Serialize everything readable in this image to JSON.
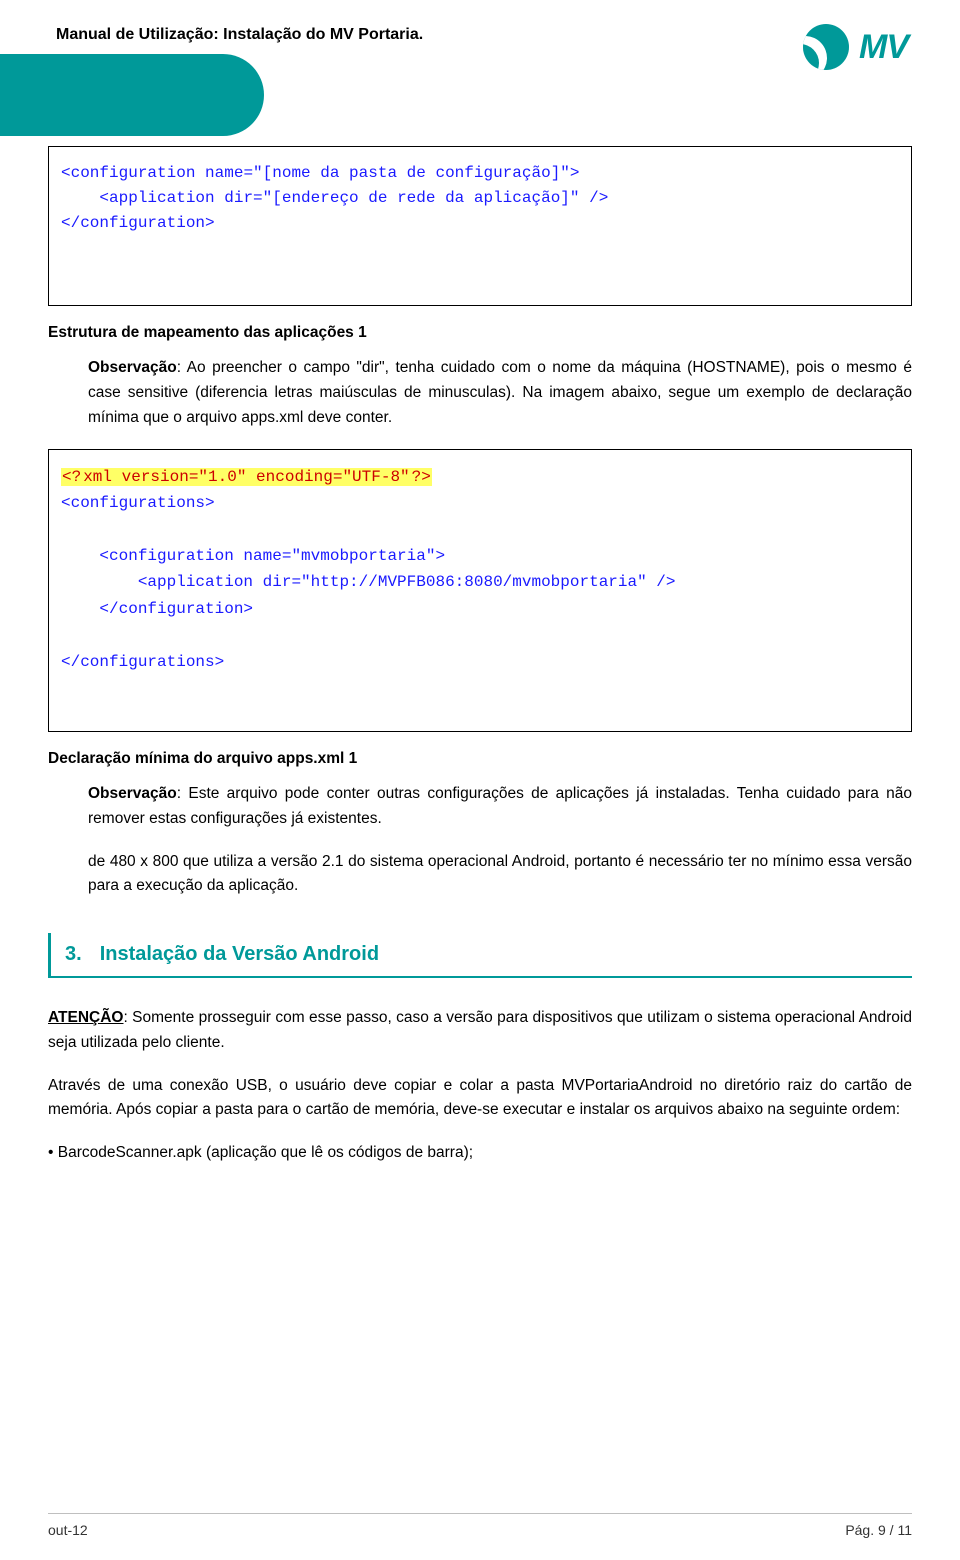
{
  "header": {
    "title": "Manual de Utilização: Instalação do MV Portaria.",
    "logo_text": "MV"
  },
  "codebox1": {
    "line1_open": "<configuration ",
    "line1_attr": "name=\"[nome da pasta de configuração]\">",
    "line2_indent": "    ",
    "line2_open": "<application ",
    "line2_attr": "dir=\"[endereço de rede da aplicação]\" />",
    "line3": "</configuration>"
  },
  "caption1": "Estrutura de mapeamento das aplicações 1",
  "para1": {
    "bold": "Observação",
    "text": ": Ao preencher o campo \"dir\", tenha cuidado com o nome da máquina (HOSTNAME), pois o mesmo é case sensitive (diferencia letras maiúsculas de minusculas). Na imagem abaixo, segue um exemplo de declaração mínima que o arquivo apps.xml deve conter."
  },
  "codebox2": {
    "decl_open": "<?",
    "decl_body": "xml version=\"1.0\" encoding=\"UTF-8\"",
    "decl_close": "?>",
    "l2": "<configurations>",
    "blank": "",
    "l4": "    <configuration name=\"mvmobportaria\">",
    "l5": "        <application dir=\"http://MVPFB086:8080/mvmobportaria\" />",
    "l6": "    </configuration>",
    "l8": "</configurations>"
  },
  "caption2": "Declaração mínima do arquivo apps.xml 1",
  "para2": {
    "bold": "Observação",
    "text": ": Este arquivo pode conter outras configurações de aplicações já instaladas. Tenha cuidado para não remover estas configurações já existentes."
  },
  "para3": "de 480 x 800 que utiliza a versão 2.1 do sistema operacional Android, portanto é necessário ter no mínimo essa versão para a execução da aplicação.",
  "section": {
    "num": "3.",
    "title": "Instalação da Versão Android"
  },
  "para4": {
    "bold": "ATENÇÃO",
    "text": ": Somente prosseguir com esse passo, caso a versão para dispositivos que utilizam o sistema operacional Android seja utilizada pelo cliente."
  },
  "para5": "Através de uma conexão USB, o usuário deve copiar e colar a pasta MVPortariaAndroid no diretório raiz do cartão de memória. Após copiar a pasta para o cartão de memória, deve-se executar e instalar os arquivos abaixo na seguinte ordem:",
  "bullet1": "• BarcodeScanner.apk (aplicação que lê os códigos de barra);",
  "footer": {
    "left": "out-12",
    "right": "Pág. 9 / 11"
  }
}
